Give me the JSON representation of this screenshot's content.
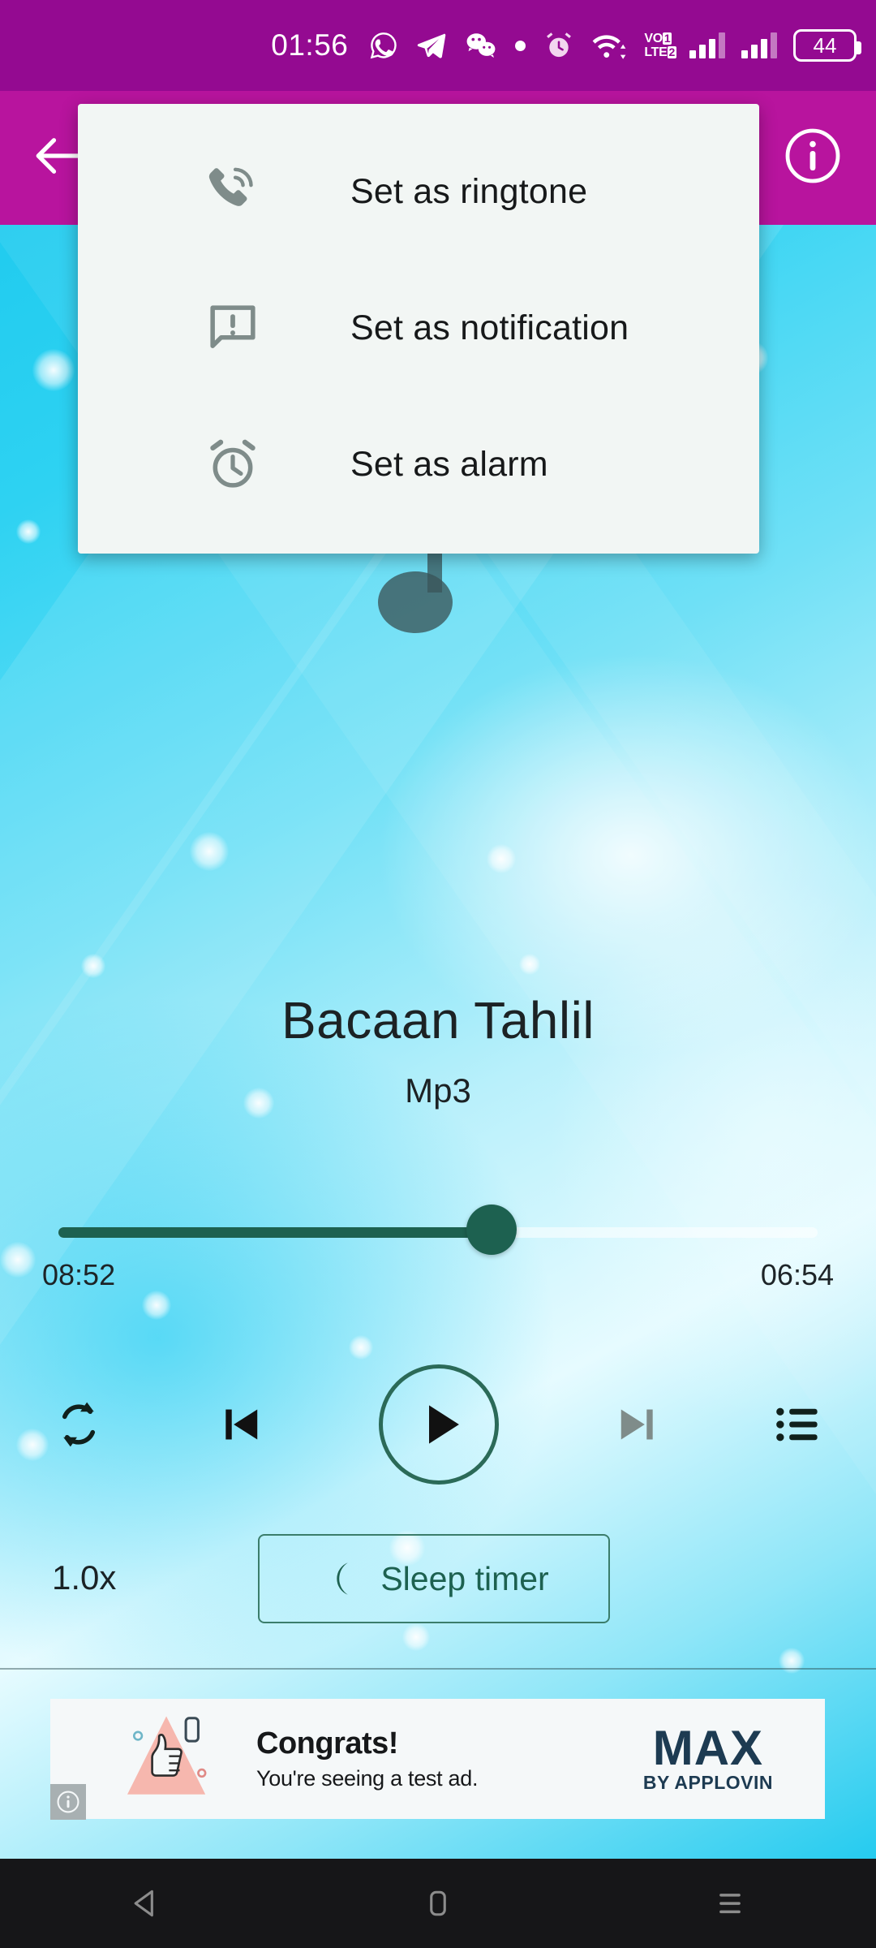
{
  "status_bar": {
    "time": "01:56",
    "battery_level": "44",
    "icons": [
      "whatsapp-icon",
      "telegram-icon",
      "wechat-icon",
      "dot-icon",
      "alarm-icon",
      "wifi-icon",
      "volte-icon",
      "signal-icon-1",
      "signal-icon-2",
      "battery-icon"
    ],
    "volte_line1": "VO",
    "volte_line2": "LTE",
    "volte_sim1": "1",
    "volte_sim2": "2",
    "background_color": "#940a91"
  },
  "app_bar": {
    "back_icon": "arrow-left-icon",
    "info_icon": "info-circle-icon",
    "background_color": "#b8149e"
  },
  "popup_menu": {
    "items": [
      {
        "label": "Set as ringtone",
        "icon": "phone-ring-icon"
      },
      {
        "label": "Set as notification",
        "icon": "chat-alert-icon"
      },
      {
        "label": "Set as alarm",
        "icon": "alarm-clock-icon"
      }
    ],
    "background_color": "#f2f6f4"
  },
  "player": {
    "title": "Bacaan Tahlil",
    "subtitle": "Mp3",
    "time_elapsed": "08:52",
    "time_remaining": "06:54",
    "progress_percent": 57,
    "accent_color": "#1d6150",
    "controls": [
      {
        "name": "repeat-button",
        "icon": "repeat-icon"
      },
      {
        "name": "previous-button",
        "icon": "skip-previous-icon"
      },
      {
        "name": "play-button",
        "icon": "play-icon"
      },
      {
        "name": "next-button",
        "icon": "skip-next-icon"
      },
      {
        "name": "playlist-button",
        "icon": "playlist-icon"
      }
    ],
    "speed": "1.0x",
    "sleep_timer_label": "Sleep timer",
    "sleep_timer_icon": "moon-icon"
  },
  "ad": {
    "headline": "Congrats!",
    "subtext": "You're seeing a test ad.",
    "brand": "MAX",
    "brand_sub": "BY APPLOVIN",
    "info_icon": "ad-info-icon"
  },
  "nav_bar": {
    "buttons": [
      {
        "name": "nav-back-button",
        "icon": "triangle-back-icon"
      },
      {
        "name": "nav-home-button",
        "icon": "home-square-icon"
      },
      {
        "name": "nav-recent-button",
        "icon": "menu-lines-icon"
      }
    ],
    "background_color": "#161618"
  }
}
